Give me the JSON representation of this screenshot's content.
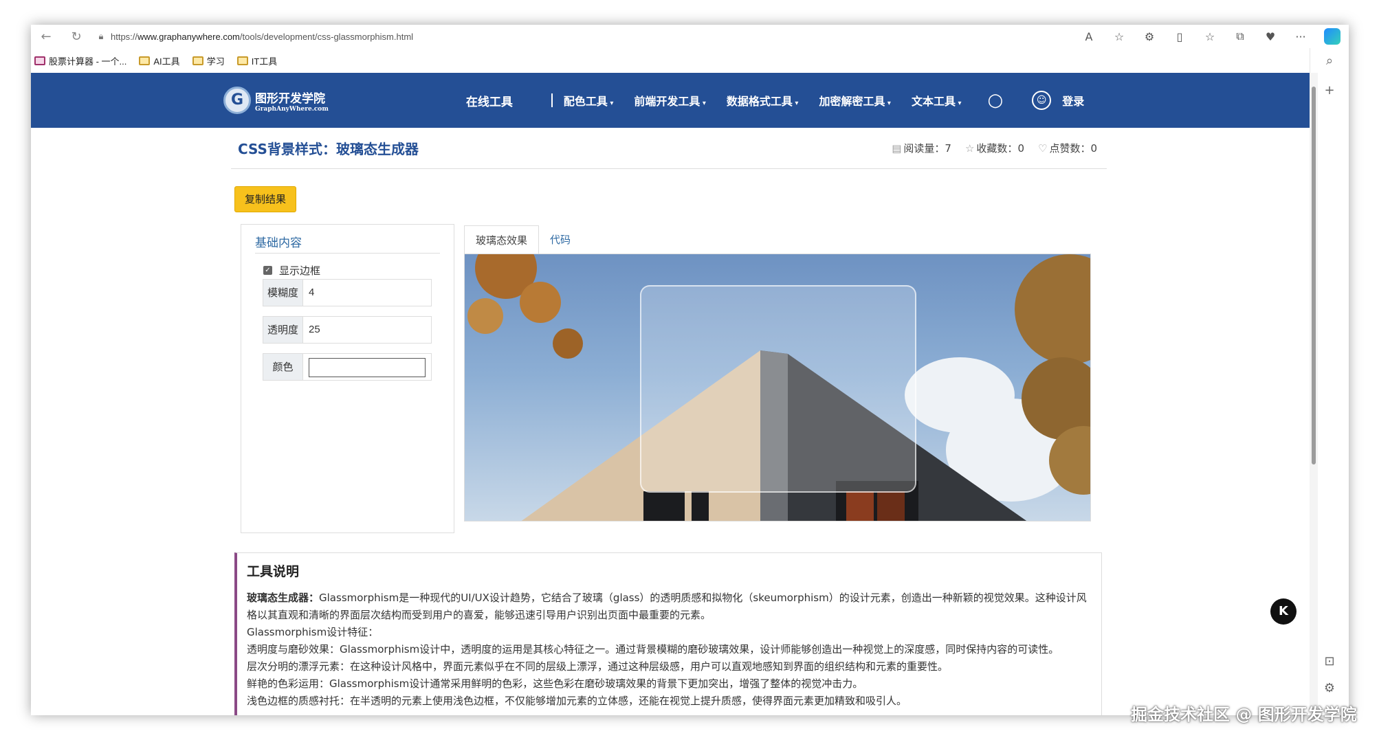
{
  "browser": {
    "url_prefix": "https://",
    "url_host": "www.graphanywhere.com",
    "url_path": "/tools/development/css-glassmorphism.html",
    "favorites": [
      {
        "label": "股票计算器 - 一个...",
        "icon": "app-icon"
      },
      {
        "label": "AI工具",
        "icon": "folder-icon"
      },
      {
        "label": "学习",
        "icon": "folder-icon"
      },
      {
        "label": "IT工具",
        "icon": "folder-icon"
      }
    ]
  },
  "site": {
    "logo_cn": "图形开发学院",
    "logo_en": "GraphAnyWhere.com",
    "logo_letter": "G",
    "nav_main": "在线工具",
    "nav_items": [
      "配色工具",
      "前端开发工具",
      "数据格式工具",
      "加密解密工具",
      "文本工具"
    ],
    "login": "登录"
  },
  "page": {
    "title": "CSS背景样式：玻璃态生成器",
    "stats": {
      "views_label": "阅读量：",
      "views": "7",
      "favorites_label": "收藏数：",
      "favorites": "0",
      "likes_label": "点赞数：",
      "likes": "0"
    },
    "copy_button": "复制结果"
  },
  "settings": {
    "section_title": "基础内容",
    "show_border_label": "显示边框",
    "show_border_checked": true,
    "blur_label": "模糊度",
    "blur_value": "4",
    "opacity_label": "透明度",
    "opacity_value": "25",
    "color_label": "颜色",
    "color_value": ""
  },
  "tabs": [
    "玻璃态效果",
    "代码"
  ],
  "description": {
    "heading": "工具说明",
    "lead_bold": "玻璃态生成器：",
    "lead": "Glassmorphism是一种现代的UI/UX设计趋势，它结合了玻璃（glass）的透明质感和拟物化（skeumorphism）的设计元素，创造出一种新颖的视觉效果。这种设计风格以其直观和清晰的界面层次结构而受到用户的喜爱，能够迅速引导用户识别出页面中最重要的元素。",
    "features_title": "Glassmorphism设计特征：",
    "feature_1": "透明度与磨砂效果：Glassmorphism设计中，透明度的运用是其核心特征之一。通过背景模糊的磨砂玻璃效果，设计师能够创造出一种视觉上的深度感，同时保持内容的可读性。",
    "feature_2": "层次分明的漂浮元素：在这种设计风格中，界面元素似乎在不同的层级上漂浮，通过这种层级感，用户可以直观地感知到界面的组织结构和元素的重要性。",
    "feature_3": "鲜艳的色彩运用：Glassmorphism设计通常采用鲜明的色彩，这些色彩在磨砂玻璃效果的背景下更加突出，增强了整体的视觉冲击力。",
    "feature_4": "浅色边框的质感衬托：在半透明的元素上使用浅色边框，不仅能够增加元素的立体感，还能在视觉上提升质感，使得界面元素更加精致和吸引人。"
  },
  "watermark": "掘金技术社区 @ 图形开发学院",
  "badge_letter": "K"
}
